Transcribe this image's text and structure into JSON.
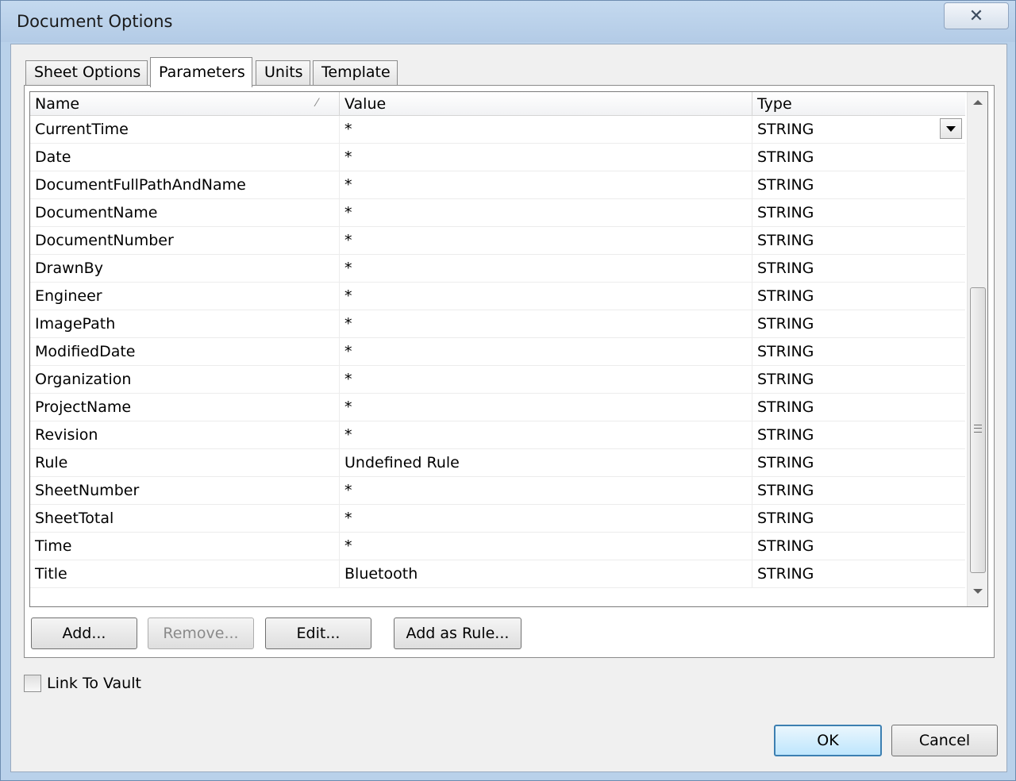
{
  "window": {
    "title": "Document Options",
    "close_glyph": "✕"
  },
  "tabs": [
    {
      "label": "Sheet Options",
      "active": false
    },
    {
      "label": "Parameters",
      "active": true
    },
    {
      "label": "Units",
      "active": false
    },
    {
      "label": "Template",
      "active": false
    }
  ],
  "grid": {
    "columns": [
      "Name",
      "Value",
      "Type"
    ],
    "sort_glyph": "⁄",
    "rows": [
      {
        "name": "CurrentTime",
        "value": "*",
        "type": "STRING"
      },
      {
        "name": "Date",
        "value": "*",
        "type": "STRING"
      },
      {
        "name": "DocumentFullPathAndName",
        "value": "*",
        "type": "STRING"
      },
      {
        "name": "DocumentName",
        "value": "*",
        "type": "STRING"
      },
      {
        "name": "DocumentNumber",
        "value": "*",
        "type": "STRING"
      },
      {
        "name": "DrawnBy",
        "value": "*",
        "type": "STRING"
      },
      {
        "name": "Engineer",
        "value": "*",
        "type": "STRING"
      },
      {
        "name": "ImagePath",
        "value": "*",
        "type": "STRING"
      },
      {
        "name": "ModifiedDate",
        "value": "*",
        "type": "STRING"
      },
      {
        "name": "Organization",
        "value": "*",
        "type": "STRING"
      },
      {
        "name": "ProjectName",
        "value": "*",
        "type": "STRING"
      },
      {
        "name": "Revision",
        "value": "*",
        "type": "STRING"
      },
      {
        "name": "Rule",
        "value": "Undefined Rule",
        "type": "STRING"
      },
      {
        "name": "SheetNumber",
        "value": "*",
        "type": "STRING"
      },
      {
        "name": "SheetTotal",
        "value": "*",
        "type": "STRING"
      },
      {
        "name": "Time",
        "value": "*",
        "type": "STRING"
      },
      {
        "name": "Title",
        "value": "Bluetooth",
        "type": "STRING"
      }
    ]
  },
  "actions": {
    "add": "Add...",
    "remove": "Remove...",
    "edit": "Edit...",
    "add_as_rule": "Add as Rule..."
  },
  "link_to_vault": {
    "label": "Link To Vault",
    "checked": false
  },
  "footer": {
    "ok": "OK",
    "cancel": "Cancel"
  }
}
